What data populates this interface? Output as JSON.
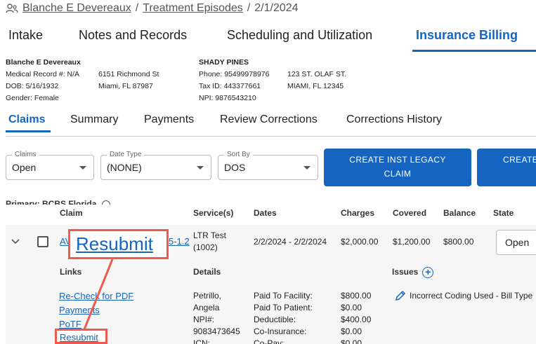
{
  "breadcrumb": {
    "patient": "Blanche E Devereaux",
    "section": "Treatment Episodes",
    "date": "2/1/2024"
  },
  "main_tabs": [
    {
      "label": "Intake"
    },
    {
      "label": "Notes and Records"
    },
    {
      "label": "Scheduling and Utilization"
    },
    {
      "label": "Insurance Billing"
    }
  ],
  "patient_info": {
    "name": "Blanche E Devereaux",
    "mrn": "Medical Record #: N/A",
    "dob": "DOB: 5/16/1932",
    "gender": "Gender: Female",
    "address1": "6151 Richmond St",
    "address2": "Miami, FL 87987"
  },
  "facility_info": {
    "name": "SHADY PINES",
    "phone": "Phone: 95499978976",
    "tax_id": "Tax ID: 443377661",
    "npi": "NPI: 9876543210",
    "address1": "123 ST. OLAF ST.",
    "address2": "MIAMI, FL 12345"
  },
  "sub_tabs": [
    {
      "label": "Claims"
    },
    {
      "label": "Summary"
    },
    {
      "label": "Payments"
    },
    {
      "label": "Review Corrections"
    },
    {
      "label": "Corrections History"
    }
  ],
  "filters": {
    "claims": {
      "label": "Claims",
      "value": "Open"
    },
    "date_type": {
      "label": "Date Type",
      "value": "(NONE)"
    },
    "sort_by": {
      "label": "Sort By",
      "value": "DOS"
    }
  },
  "buttons": {
    "create_inst_legacy": "CREATE INST LEGACY CLAIM",
    "create_other": "CREATE"
  },
  "primary_label": "Primary: BCBS Florida",
  "table_headers": {
    "claim": "Claim",
    "services": "Service(s)",
    "dates": "Dates",
    "charges": "Charges",
    "covered": "Covered",
    "balance": "Balance",
    "state": "State"
  },
  "claim_row": {
    "claim_id_prefix": "AV",
    "claim_id_suffix": "5-1.2",
    "service_line1": "LTR Test",
    "service_line2": "(1002)",
    "dates": "2/2/2024 - 2/2/2024",
    "charges": "$2,000.00",
    "covered": "$1,200.00",
    "balance": "$800.00",
    "state": "Open"
  },
  "callout": {
    "large_label": "Resubmit",
    "small_label": "Resubmit",
    "color": "#f05a4a"
  },
  "details_section": {
    "links_header": "Links",
    "details_header": "Details",
    "issues_header": "Issues",
    "links": [
      "Re-Check for PDF",
      "Payments",
      "PoTF"
    ],
    "provider_lines": [
      "Petrillo,",
      "Angela",
      "NPI#:",
      "9083473645",
      "ICN:"
    ],
    "detail_labels": [
      "Paid To Facility:",
      "Paid To Patient:",
      "Deductible:",
      "Co-Insurance:",
      "Co-Pay:"
    ],
    "detail_values": [
      "$800.00",
      "$0.00",
      "$400.00",
      "$0.00",
      "$0.00"
    ],
    "issue_text": "Incorrect Coding Used - Bill Type"
  },
  "icons": {
    "patient": "user-group-icon",
    "expand": "chevron-down-icon",
    "add": "plus-circle-icon",
    "edit": "pencil-icon",
    "info": "info-circle-icon"
  },
  "colors": {
    "accent": "#1565c0",
    "highlight": "#f05a4a"
  }
}
